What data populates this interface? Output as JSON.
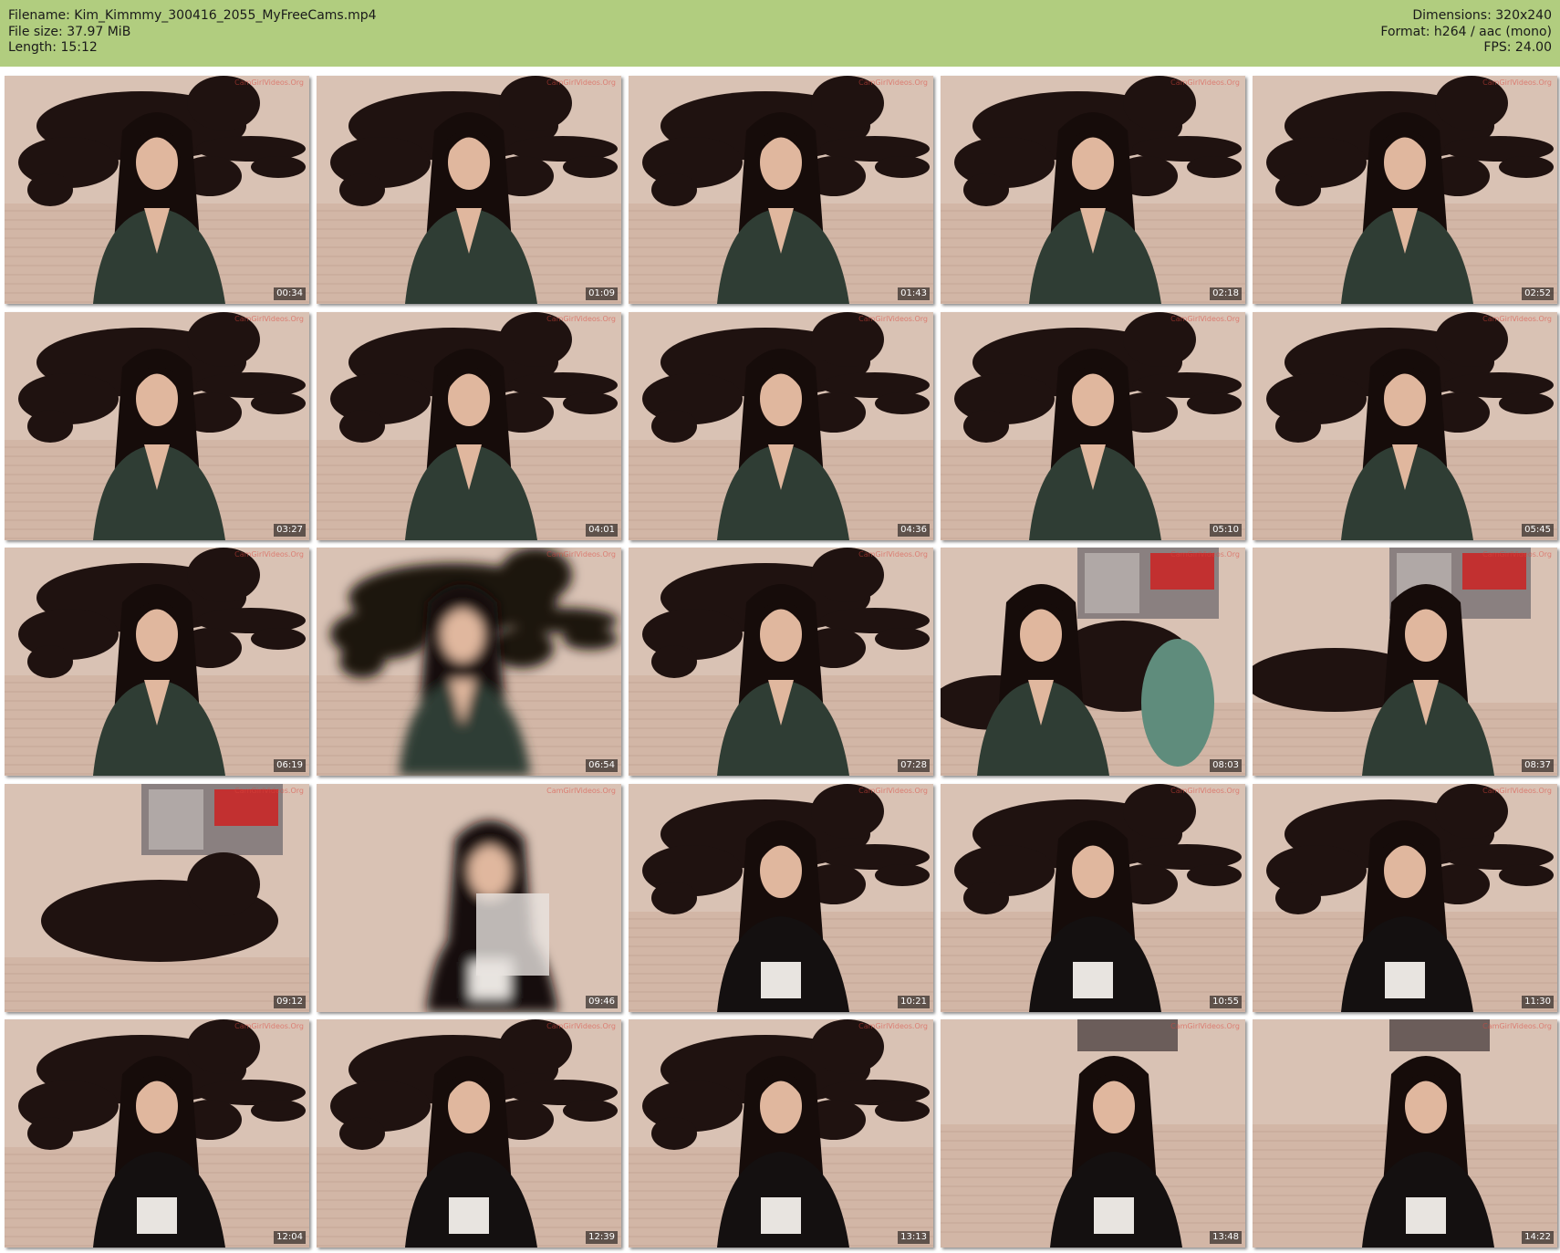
{
  "meta": {
    "filename": "Filename: Kim_Kimmmy_300416_2055_MyFreeCams.mp4",
    "file_size": "File size: 37.97 MiB",
    "length": "Length: 15:12",
    "dimensions": "Dimensions: 320x240",
    "format": "Format: h264 / aac (mono)",
    "fps": "FPS: 24.00"
  },
  "colors": {
    "header_bg": "#b1cd7f",
    "wall": "#d9c2b4",
    "panther": "#1f1210",
    "hair": "#160c0a",
    "shirt_green": "#2f3d34",
    "shirt_black": "#141010",
    "skin": "#e0b79e"
  },
  "watermark": "CamGirlVideos.Org",
  "thumbnails": [
    {
      "time": "00:34",
      "scene": "panther",
      "shirt": "green"
    },
    {
      "time": "01:09",
      "scene": "panther",
      "shirt": "green"
    },
    {
      "time": "01:43",
      "scene": "panther",
      "shirt": "green"
    },
    {
      "time": "02:18",
      "scene": "panther",
      "shirt": "green"
    },
    {
      "time": "02:52",
      "scene": "panther",
      "shirt": "green"
    },
    {
      "time": "03:27",
      "scene": "panther",
      "shirt": "green"
    },
    {
      "time": "04:01",
      "scene": "panther",
      "shirt": "green"
    },
    {
      "time": "04:36",
      "scene": "panther",
      "shirt": "green"
    },
    {
      "time": "05:10",
      "scene": "panther",
      "shirt": "green"
    },
    {
      "time": "05:45",
      "scene": "panther",
      "shirt": "green"
    },
    {
      "time": "06:19",
      "scene": "panther",
      "shirt": "green"
    },
    {
      "time": "06:54",
      "scene": "blurred",
      "shirt": "green"
    },
    {
      "time": "07:28",
      "scene": "panther",
      "shirt": "green"
    },
    {
      "time": "08:03",
      "scene": "closeup",
      "shirt": "green"
    },
    {
      "time": "08:37",
      "scene": "poster",
      "shirt": "green"
    },
    {
      "time": "09:12",
      "scene": "empty",
      "shirt": "none"
    },
    {
      "time": "09:46",
      "scene": "motion",
      "shirt": "black"
    },
    {
      "time": "10:21",
      "scene": "panther",
      "shirt": "black"
    },
    {
      "time": "10:55",
      "scene": "panther",
      "shirt": "black"
    },
    {
      "time": "11:30",
      "scene": "panther",
      "shirt": "black"
    },
    {
      "time": "12:04",
      "scene": "panther",
      "shirt": "black"
    },
    {
      "time": "12:39",
      "scene": "panther",
      "shirt": "black"
    },
    {
      "time": "13:13",
      "scene": "panther",
      "shirt": "black"
    },
    {
      "time": "13:48",
      "scene": "wall",
      "shirt": "black"
    },
    {
      "time": "14:22",
      "scene": "wall",
      "shirt": "black"
    }
  ]
}
